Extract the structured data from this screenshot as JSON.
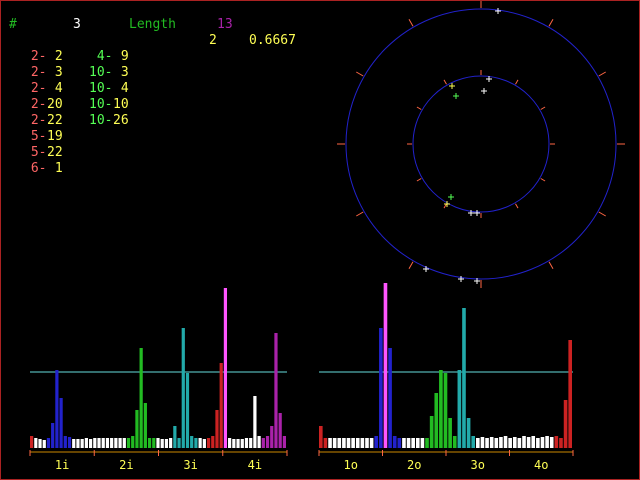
{
  "colors": {
    "red": "#cc2222",
    "salmon": "#ff6666",
    "yellow": "#ffff55",
    "green": "#22bb22",
    "lightgreen": "#55ff55",
    "cyan": "#22aaaa",
    "blue": "#2222cc",
    "magenta": "#aa22aa",
    "pink": "#ff55ff",
    "white": "#ffffff",
    "circle": "#2222cc",
    "tick": "#ff6644",
    "hline": "#66dddd"
  },
  "header": {
    "hash": "#",
    "count": "3",
    "length_label": "Length",
    "length_value": "13",
    "ratio_num": "2",
    "ratio_value": "0.6667"
  },
  "pairs": [
    {
      "a": "2",
      "b": "2",
      "ca": "salmon",
      "cb": "yellow"
    },
    {
      "a": "2",
      "b": "3",
      "ca": "salmon",
      "cb": "yellow"
    },
    {
      "a": "2",
      "b": "4",
      "ca": "salmon",
      "cb": "yellow"
    },
    {
      "a": "2",
      "b": "20",
      "ca": "salmon",
      "cb": "yellow"
    },
    {
      "a": "2",
      "b": "22",
      "ca": "salmon",
      "cb": "yellow"
    },
    {
      "a": "5",
      "b": "19",
      "ca": "salmon",
      "cb": "yellow"
    },
    {
      "a": "5",
      "b": "22",
      "ca": "salmon",
      "cb": "yellow"
    },
    {
      "a": "6",
      "b": "1",
      "ca": "salmon",
      "cb": "yellow"
    },
    {
      "a": "4",
      "b": "9",
      "ca": "lightgreen",
      "cb": "yellow"
    },
    {
      "a": "10",
      "b": "3",
      "ca": "lightgreen",
      "cb": "yellow"
    },
    {
      "a": "10",
      "b": "4",
      "ca": "lightgreen",
      "cb": "yellow"
    },
    {
      "a": "10",
      "b": "10",
      "ca": "lightgreen",
      "cb": "yellow"
    },
    {
      "a": "10",
      "b": "26",
      "ca": "lightgreen",
      "cb": "yellow"
    }
  ],
  "hist_left_labels": [
    "1i",
    "2i",
    "3i",
    "4i"
  ],
  "hist_right_labels": [
    "1o",
    "2o",
    "3o",
    "4o"
  ],
  "hist_left": [
    {
      "h": 12,
      "c": "red"
    },
    {
      "h": 10,
      "c": "white"
    },
    {
      "h": 9,
      "c": "white"
    },
    {
      "h": 8,
      "c": "white"
    },
    {
      "h": 10,
      "c": "blue"
    },
    {
      "h": 25,
      "c": "blue"
    },
    {
      "h": 78,
      "c": "blue"
    },
    {
      "h": 50,
      "c": "blue"
    },
    {
      "h": 12,
      "c": "blue"
    },
    {
      "h": 11,
      "c": "blue"
    },
    {
      "h": 9,
      "c": "white"
    },
    {
      "h": 9,
      "c": "white"
    },
    {
      "h": 9,
      "c": "white"
    },
    {
      "h": 10,
      "c": "white"
    },
    {
      "h": 9,
      "c": "white"
    },
    {
      "h": 10,
      "c": "white"
    },
    {
      "h": 10,
      "c": "white"
    },
    {
      "h": 10,
      "c": "white"
    },
    {
      "h": 10,
      "c": "white"
    },
    {
      "h": 10,
      "c": "white"
    },
    {
      "h": 10,
      "c": "white"
    },
    {
      "h": 10,
      "c": "white"
    },
    {
      "h": 10,
      "c": "white"
    },
    {
      "h": 10,
      "c": "green"
    },
    {
      "h": 12,
      "c": "green"
    },
    {
      "h": 38,
      "c": "green"
    },
    {
      "h": 100,
      "c": "green"
    },
    {
      "h": 45,
      "c": "green"
    },
    {
      "h": 10,
      "c": "green"
    },
    {
      "h": 10,
      "c": "green"
    },
    {
      "h": 10,
      "c": "white"
    },
    {
      "h": 9,
      "c": "white"
    },
    {
      "h": 9,
      "c": "white"
    },
    {
      "h": 10,
      "c": "white"
    },
    {
      "h": 22,
      "c": "cyan"
    },
    {
      "h": 10,
      "c": "cyan"
    },
    {
      "h": 120,
      "c": "cyan"
    },
    {
      "h": 75,
      "c": "cyan"
    },
    {
      "h": 12,
      "c": "cyan"
    },
    {
      "h": 10,
      "c": "cyan"
    },
    {
      "h": 10,
      "c": "white"
    },
    {
      "h": 9,
      "c": "white"
    },
    {
      "h": 10,
      "c": "red"
    },
    {
      "h": 12,
      "c": "red"
    },
    {
      "h": 38,
      "c": "red"
    },
    {
      "h": 85,
      "c": "red"
    },
    {
      "h": 160,
      "c": "pink"
    },
    {
      "h": 10,
      "c": "white"
    },
    {
      "h": 9,
      "c": "white"
    },
    {
      "h": 9,
      "c": "white"
    },
    {
      "h": 9,
      "c": "white"
    },
    {
      "h": 10,
      "c": "white"
    },
    {
      "h": 10,
      "c": "white"
    },
    {
      "h": 52,
      "c": "white"
    },
    {
      "h": 12,
      "c": "white"
    },
    {
      "h": 10,
      "c": "magenta"
    },
    {
      "h": 12,
      "c": "magenta"
    },
    {
      "h": 22,
      "c": "magenta"
    },
    {
      "h": 115,
      "c": "magenta"
    },
    {
      "h": 35,
      "c": "magenta"
    },
    {
      "h": 12,
      "c": "magenta"
    }
  ],
  "hist_right": [
    {
      "h": 22,
      "c": "red"
    },
    {
      "h": 10,
      "c": "red"
    },
    {
      "h": 10,
      "c": "white"
    },
    {
      "h": 10,
      "c": "white"
    },
    {
      "h": 10,
      "c": "white"
    },
    {
      "h": 10,
      "c": "white"
    },
    {
      "h": 10,
      "c": "white"
    },
    {
      "h": 10,
      "c": "white"
    },
    {
      "h": 10,
      "c": "white"
    },
    {
      "h": 10,
      "c": "white"
    },
    {
      "h": 10,
      "c": "white"
    },
    {
      "h": 10,
      "c": "white"
    },
    {
      "h": 12,
      "c": "blue"
    },
    {
      "h": 120,
      "c": "blue"
    },
    {
      "h": 165,
      "c": "pink"
    },
    {
      "h": 100,
      "c": "blue"
    },
    {
      "h": 12,
      "c": "blue"
    },
    {
      "h": 10,
      "c": "blue"
    },
    {
      "h": 10,
      "c": "white"
    },
    {
      "h": 10,
      "c": "white"
    },
    {
      "h": 10,
      "c": "white"
    },
    {
      "h": 10,
      "c": "white"
    },
    {
      "h": 10,
      "c": "white"
    },
    {
      "h": 10,
      "c": "green"
    },
    {
      "h": 32,
      "c": "green"
    },
    {
      "h": 55,
      "c": "green"
    },
    {
      "h": 78,
      "c": "green"
    },
    {
      "h": 75,
      "c": "green"
    },
    {
      "h": 30,
      "c": "green"
    },
    {
      "h": 12,
      "c": "green"
    },
    {
      "h": 78,
      "c": "cyan"
    },
    {
      "h": 140,
      "c": "cyan"
    },
    {
      "h": 30,
      "c": "cyan"
    },
    {
      "h": 12,
      "c": "cyan"
    },
    {
      "h": 10,
      "c": "white"
    },
    {
      "h": 11,
      "c": "white"
    },
    {
      "h": 10,
      "c": "white"
    },
    {
      "h": 11,
      "c": "white"
    },
    {
      "h": 10,
      "c": "white"
    },
    {
      "h": 11,
      "c": "white"
    },
    {
      "h": 12,
      "c": "white"
    },
    {
      "h": 10,
      "c": "white"
    },
    {
      "h": 11,
      "c": "white"
    },
    {
      "h": 10,
      "c": "white"
    },
    {
      "h": 12,
      "c": "white"
    },
    {
      "h": 11,
      "c": "white"
    },
    {
      "h": 12,
      "c": "white"
    },
    {
      "h": 10,
      "c": "white"
    },
    {
      "h": 11,
      "c": "white"
    },
    {
      "h": 12,
      "c": "white"
    },
    {
      "h": 11,
      "c": "white"
    },
    {
      "h": 12,
      "c": "red"
    },
    {
      "h": 10,
      "c": "red"
    },
    {
      "h": 48,
      "c": "red"
    },
    {
      "h": 108,
      "c": "red"
    }
  ]
}
